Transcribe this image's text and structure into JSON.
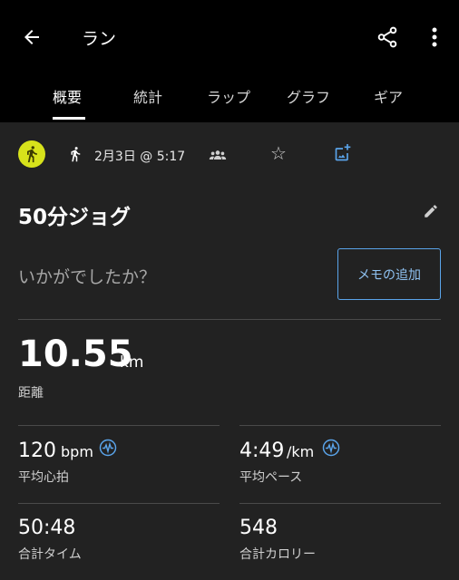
{
  "header": {
    "title": "ラン"
  },
  "tabs": [
    {
      "label": "概要"
    },
    {
      "label": "統計"
    },
    {
      "label": "ラップ"
    },
    {
      "label": "グラフ"
    },
    {
      "label": "ギア"
    }
  ],
  "meta": {
    "date": "2月3日 @ 5:17"
  },
  "activity": {
    "name": "50分ジョグ",
    "prompt": "いかがでしたか？",
    "memo_button": "メモの追加"
  },
  "distance": {
    "value": "10.55",
    "unit": "km",
    "label": "距離"
  },
  "stats": {
    "heart_rate": {
      "value": "120",
      "unit": "bpm",
      "label": "平均心拍"
    },
    "pace": {
      "value": "4:49",
      "unit": "/km",
      "label": "平均ペース"
    },
    "time": {
      "value": "50:48",
      "label": "合計タイム"
    },
    "calories": {
      "value": "548",
      "label": "合計カロリー"
    }
  },
  "colors": {
    "activity_icon": "#d7e21b",
    "accent_blue": "#5aa4ea",
    "background": "#222222",
    "header": "#000000"
  }
}
